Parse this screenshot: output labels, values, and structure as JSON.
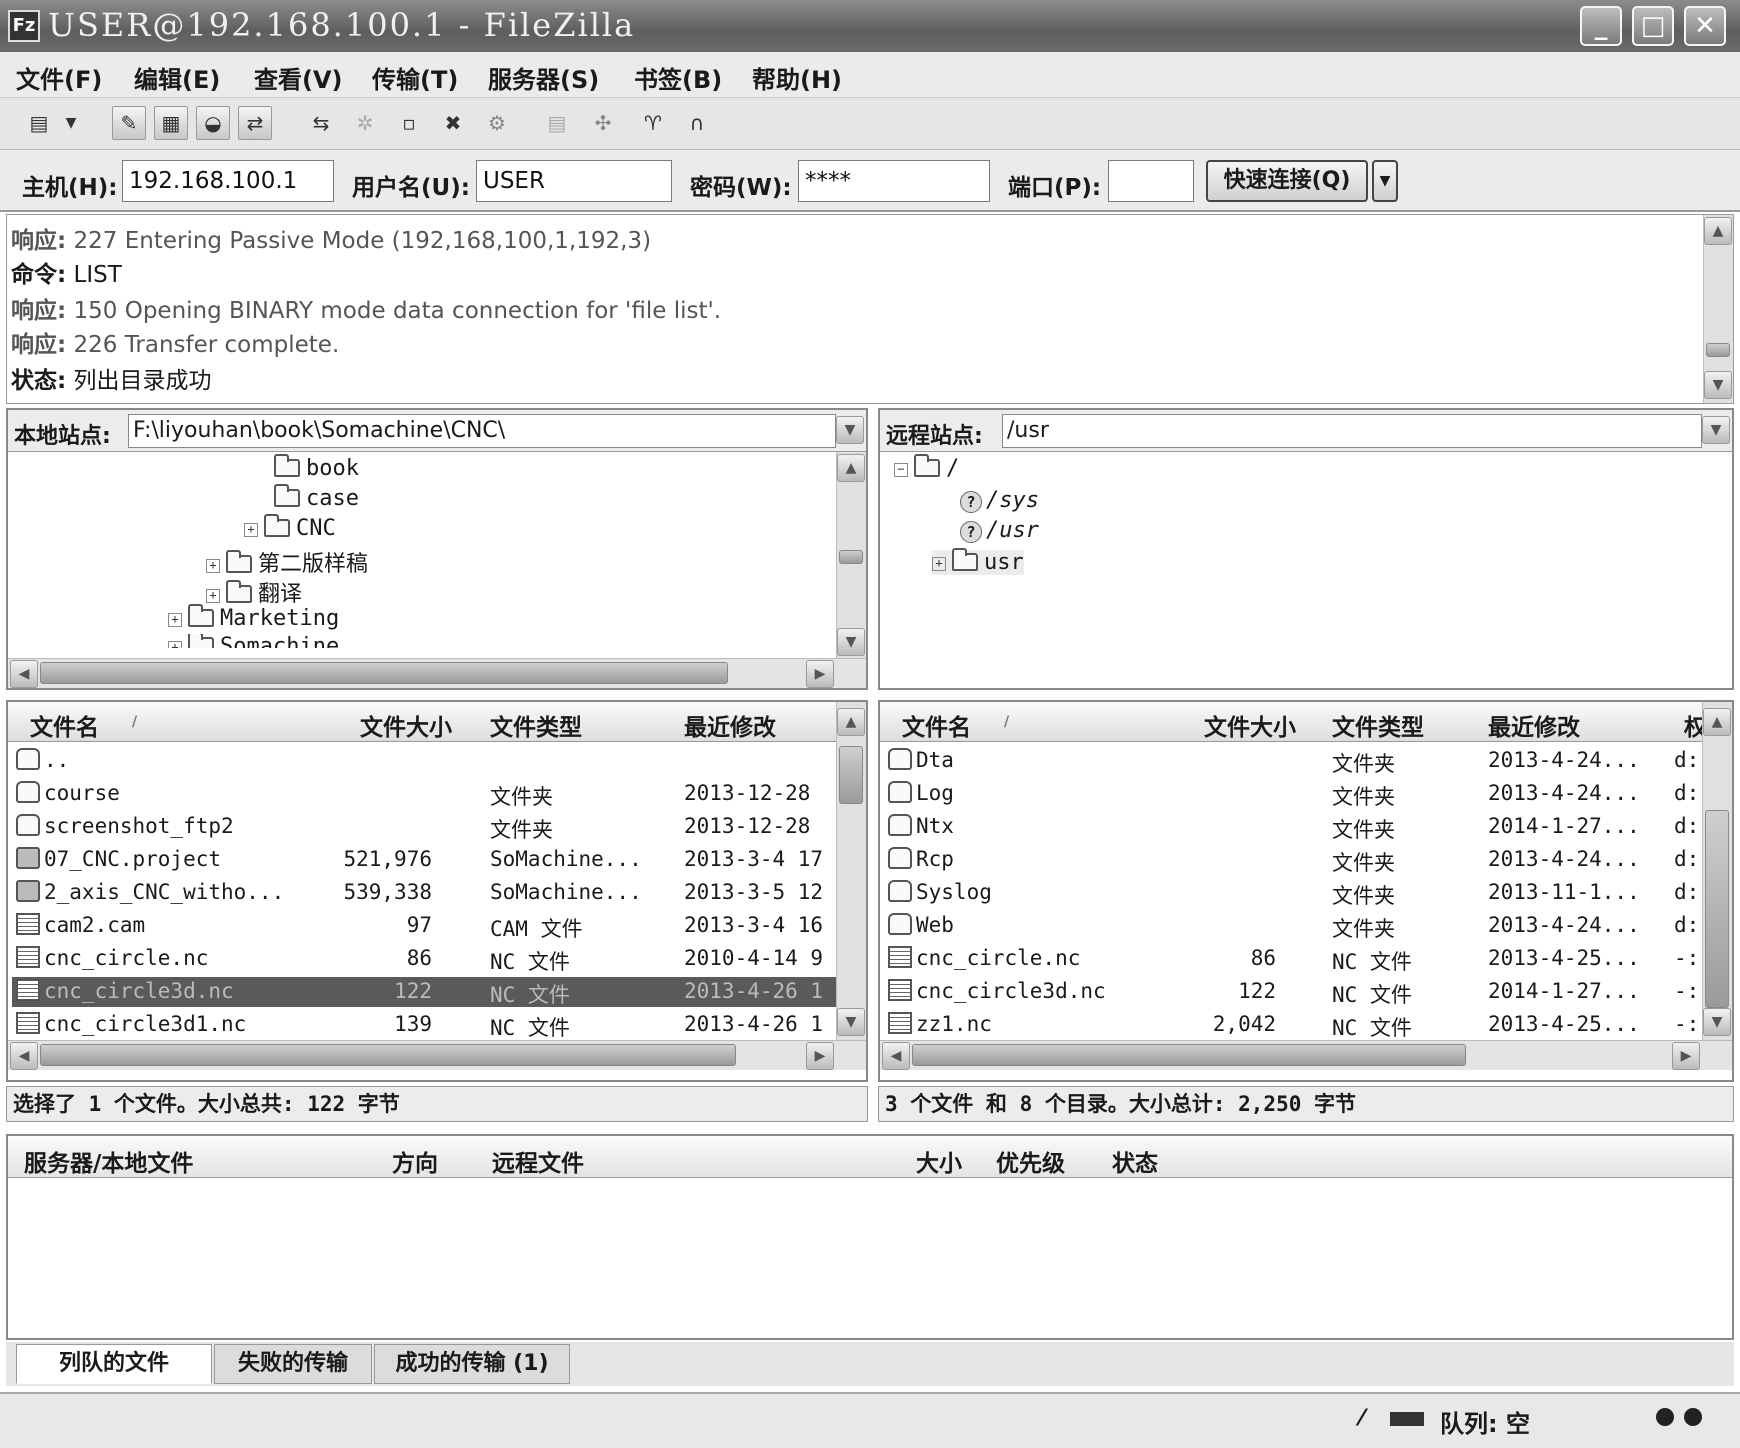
{
  "window": {
    "title": "USER@192.168.100.1 - FileZilla",
    "app_icon": "Fz",
    "buttons": [
      "minimize-icon",
      "maximize-icon",
      "close-icon"
    ]
  },
  "menu": [
    "文件(F)",
    "编辑(E)",
    "查看(V)",
    "传输(T)",
    "服务器(S)",
    "书签(B)",
    "帮助(H)"
  ],
  "connect": {
    "host_label": "主机(H):",
    "host": "192.168.100.1",
    "user_label": "用户名(U):",
    "user": "USER",
    "pass_label": "密码(W):",
    "pass": "****",
    "port_label": "端口(P):",
    "port": "",
    "quickconnect": "快速连接(Q)"
  },
  "log": [
    {
      "label": "响应:",
      "text": "227 Entering Passive Mode (192,168,100,1,192,3)"
    },
    {
      "label": "命令:",
      "text": "LIST"
    },
    {
      "label": "响应:",
      "text": "150 Opening BINARY mode data connection for 'file list'."
    },
    {
      "label": "响应:",
      "text": "226 Transfer complete."
    },
    {
      "label": "状态:",
      "text": "列出目录成功"
    }
  ],
  "local": {
    "site_label": "本地站点:",
    "path": "F:\\liyouhan\\book\\Somachine\\CNC\\",
    "tree": [
      "book",
      "case",
      "CNC",
      "第二版样稿",
      "翻译",
      "Marketing",
      "Somachine"
    ],
    "columns": [
      "文件名",
      "文件大小",
      "文件类型",
      "最近修改"
    ],
    "files": [
      {
        "name": "..",
        "size": "",
        "type": "",
        "date": "",
        "icon": "folder"
      },
      {
        "name": "course",
        "size": "",
        "type": "文件夹",
        "date": "2013-12-28",
        "icon": "folder"
      },
      {
        "name": "screenshot_ftp2",
        "size": "",
        "type": "文件夹",
        "date": "2013-12-28",
        "icon": "folder"
      },
      {
        "name": "07_CNC.project",
        "size": "521,976",
        "type": "SoMachine...",
        "date": "2013-3-4 17",
        "icon": "proj"
      },
      {
        "name": "2_axis_CNC_witho...",
        "size": "539,338",
        "type": "SoMachine...",
        "date": "2013-3-5 12",
        "icon": "proj"
      },
      {
        "name": "cam2.cam",
        "size": "97",
        "type": "CAM 文件",
        "date": "2013-3-4 16",
        "icon": "file"
      },
      {
        "name": "cnc_circle.nc",
        "size": "86",
        "type": "NC 文件",
        "date": "2010-4-14 9",
        "icon": "file"
      },
      {
        "name": "cnc_circle3d.nc",
        "size": "122",
        "type": "NC 文件",
        "date": "2013-4-26 1",
        "icon": "file"
      },
      {
        "name": "cnc_circle3d1.nc",
        "size": "139",
        "type": "NC 文件",
        "date": "2013-4-26 1",
        "icon": "file"
      }
    ],
    "status": "选择了 1 个文件。大小总共: 122 字节"
  },
  "remote": {
    "site_label": "远程站点:",
    "path": "/usr",
    "tree": [
      "/",
      "/sys",
      "/usr",
      "usr"
    ],
    "columns": [
      "文件名",
      "文件大小",
      "文件类型",
      "最近修改",
      "权"
    ],
    "files": [
      {
        "name": "Dta",
        "size": "",
        "type": "文件夹",
        "date": "2013-4-24...",
        "perm": "d:",
        "icon": "folder"
      },
      {
        "name": "Log",
        "size": "",
        "type": "文件夹",
        "date": "2013-4-24...",
        "perm": "d:",
        "icon": "folder"
      },
      {
        "name": "Ntx",
        "size": "",
        "type": "文件夹",
        "date": "2014-1-27...",
        "perm": "d:",
        "icon": "folder"
      },
      {
        "name": "Rcp",
        "size": "",
        "type": "文件夹",
        "date": "2013-4-24...",
        "perm": "d:",
        "icon": "folder"
      },
      {
        "name": "Syslog",
        "size": "",
        "type": "文件夹",
        "date": "2013-11-1...",
        "perm": "d:",
        "icon": "folder"
      },
      {
        "name": "Web",
        "size": "",
        "type": "文件夹",
        "date": "2013-4-24...",
        "perm": "d:",
        "icon": "folder"
      },
      {
        "name": "cnc_circle.nc",
        "size": "86",
        "type": "NC 文件",
        "date": "2013-4-25...",
        "perm": "-:",
        "icon": "file"
      },
      {
        "name": "cnc_circle3d.nc",
        "size": "122",
        "type": "NC 文件",
        "date": "2014-1-27...",
        "perm": "-:",
        "icon": "file"
      },
      {
        "name": "zz1.nc",
        "size": "2,042",
        "type": "NC 文件",
        "date": "2013-4-25...",
        "perm": "-:",
        "icon": "file"
      }
    ],
    "status": "3 个文件 和 8 个目录。大小总计: 2,250 字节"
  },
  "queue": {
    "columns": [
      "服务器/本地文件",
      "方向",
      "远程文件",
      "大小",
      "优先级",
      "状态"
    ],
    "tabs": [
      "列队的文件",
      "失败的传输",
      "成功的传输 (1)"
    ]
  },
  "statusbar": {
    "queue": "队列: 空"
  }
}
